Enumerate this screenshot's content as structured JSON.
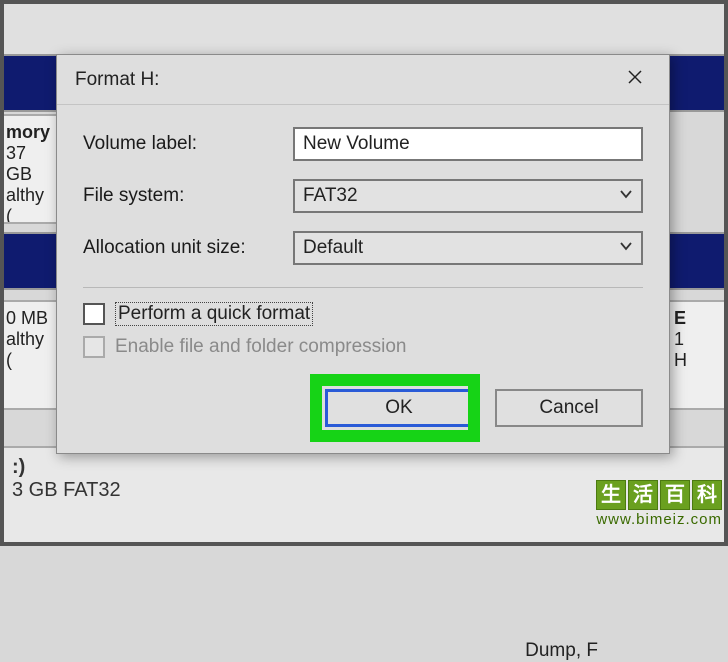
{
  "dialog": {
    "title": "Format H:",
    "volume_label_label": "Volume label:",
    "volume_label_value": "New Volume",
    "file_system_label": "File system:",
    "file_system_value": "FAT32",
    "allocation_label": "Allocation unit size:",
    "allocation_value": "Default",
    "quick_format_label": "Perform a quick format",
    "enable_compression_label": "Enable file and folder compression",
    "ok_label": "OK",
    "cancel_label": "Cancel"
  },
  "background": {
    "left1_line1": "mory",
    "left1_line2": "37 GB",
    "left1_line3": "althy (",
    "left2_line1": "0 MB",
    "left2_line2": "althy (",
    "right_line1": "E",
    "right_line2": "1",
    "right_line3": "H",
    "mid_text": "Dump, F",
    "bottom_line1": ":)",
    "bottom_line2": "3 GB FAT32"
  },
  "watermark": {
    "c1": "生",
    "c2": "活",
    "c3": "百",
    "c4": "科",
    "url": "www.bimeiz.com"
  }
}
